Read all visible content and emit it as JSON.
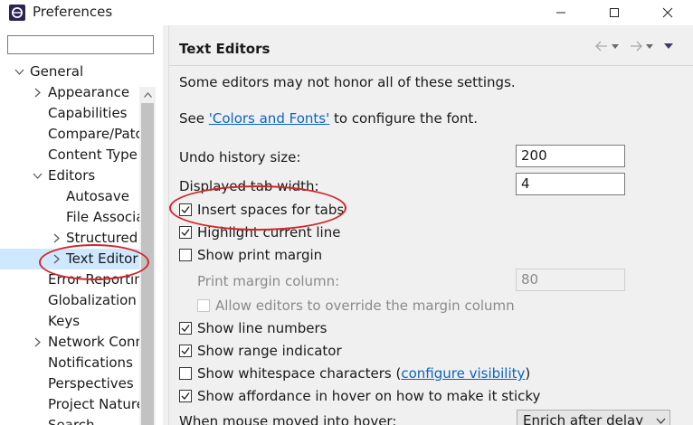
{
  "window": {
    "title": "Preferences"
  },
  "filter": {
    "value": "",
    "placeholder": ""
  },
  "tree": {
    "items": [
      {
        "label": "General"
      },
      {
        "label": "Appearance"
      },
      {
        "label": "Capabilities"
      },
      {
        "label": "Compare/Patc"
      },
      {
        "label": "Content Type"
      },
      {
        "label": "Editors"
      },
      {
        "label": "Autosave"
      },
      {
        "label": "File Associa"
      },
      {
        "label": "Structured"
      },
      {
        "label": "Text Editor"
      },
      {
        "label": "Error Reportin"
      },
      {
        "label": "Globalization"
      },
      {
        "label": "Keys"
      },
      {
        "label": "Network Conn"
      },
      {
        "label": "Notifications"
      },
      {
        "label": "Perspectives"
      },
      {
        "label": "Project Nature"
      },
      {
        "label": "Search"
      }
    ]
  },
  "page": {
    "title": "Text Editors",
    "note": "Some editors may not honor all of these settings.",
    "font_prefix": "See ",
    "font_link": "'Colors and Fonts'",
    "font_suffix": " to configure the font.",
    "undo_label": "Undo history size:",
    "undo_value": "200",
    "tab_label": "Displayed tab width:",
    "tab_value": "4",
    "checkboxes": [
      {
        "label": "Insert spaces for tabs",
        "checked": true
      },
      {
        "label": "Highlight current line",
        "checked": true
      },
      {
        "label": "Show print margin",
        "checked": false
      }
    ],
    "margin_label": "Print margin column:",
    "margin_value": "80",
    "allow_override": {
      "label": "Allow editors to override the margin column",
      "checked": false
    },
    "checkboxes2": [
      {
        "label": "Show line numbers",
        "checked": true
      },
      {
        "label": "Show range indicator",
        "checked": true
      }
    ],
    "whitespace": {
      "label": "Show whitespace characters (",
      "link": "configure visibility",
      "suffix": ")",
      "checked": false
    },
    "affordance": {
      "label": "Show affordance in hover on how to make it sticky",
      "checked": true
    },
    "hover_label": "When mouse moved into hover:",
    "hover_value": "Enrich after delay"
  },
  "colors": {
    "annotation": "#d22828",
    "link": "#0b63c5",
    "pane_bg": "#f0f0f0"
  }
}
